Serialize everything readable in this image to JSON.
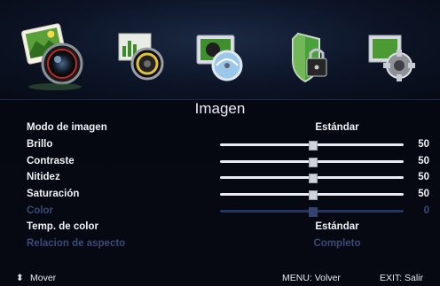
{
  "top_menu": {
    "items": [
      {
        "icon": "picture-camera-icon",
        "selected": true
      },
      {
        "icon": "sound-equalizer-icon",
        "selected": false
      },
      {
        "icon": "channel-satellite-icon",
        "selected": false
      },
      {
        "icon": "lock-shield-icon",
        "selected": false
      },
      {
        "icon": "settings-gear-icon",
        "selected": false
      }
    ]
  },
  "title": "Imagen",
  "rows": [
    {
      "label": "Modo de imagen",
      "value": "Estándar"
    },
    {
      "label": "Brillo",
      "level": 50,
      "value": "50"
    },
    {
      "label": "Contraste",
      "level": 50,
      "value": "50"
    },
    {
      "label": "Nitidez",
      "level": 50,
      "value": "50"
    },
    {
      "label": "Saturación",
      "level": 50,
      "value": "50"
    },
    {
      "label": "Color",
      "level": 0,
      "value": "0"
    },
    {
      "label": "Temp. de color",
      "value": "Estándar"
    },
    {
      "label": "Relacion de aspecto",
      "value": "Completo"
    }
  ],
  "footer": {
    "move_icon": "⬍",
    "move": "Mover",
    "menu": "MENU: Volver",
    "exit": "EXIT: Salir"
  }
}
